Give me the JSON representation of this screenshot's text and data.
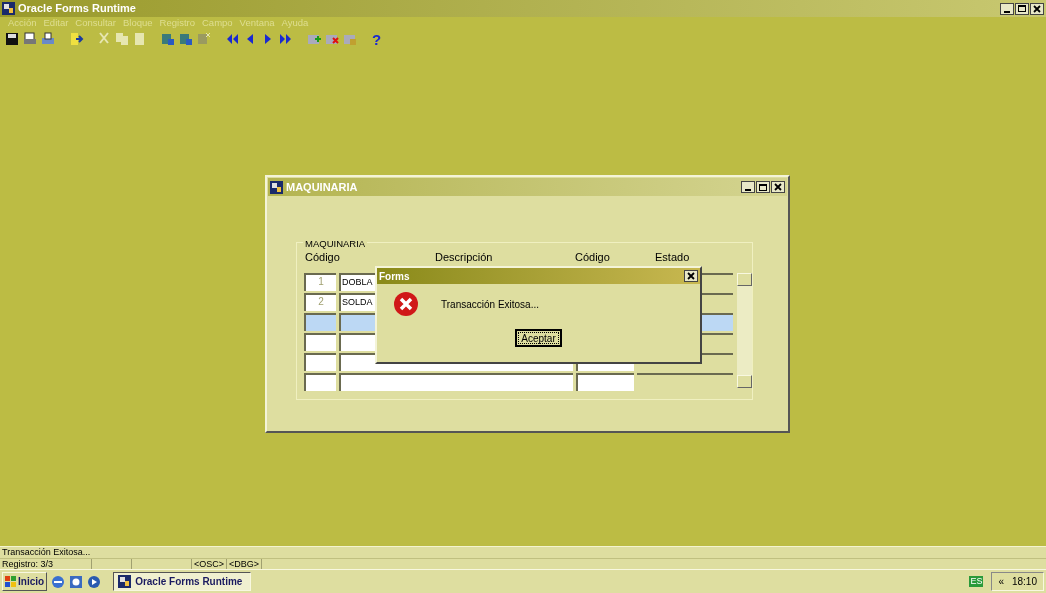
{
  "app_window": {
    "title": "Oracle Forms Runtime"
  },
  "menu": [
    {
      "label": "Acción",
      "disabled": true
    },
    {
      "label": "Editar",
      "disabled": true
    },
    {
      "label": "Consultar",
      "disabled": true
    },
    {
      "label": "Bloque",
      "disabled": true
    },
    {
      "label": "Registro",
      "disabled": true
    },
    {
      "label": "Campo",
      "disabled": true
    },
    {
      "label": "Ventana",
      "disabled": true
    },
    {
      "label": "Ayuda",
      "disabled": true
    }
  ],
  "help_button": "?",
  "form_window": {
    "title": "MAQUINARIA",
    "frame_title": "MAQUINARIA",
    "columns": [
      "Código",
      "Descripción",
      "Código",
      "Estado"
    ],
    "rows": [
      {
        "code": "1",
        "description": "DOBLA",
        "selected": false
      },
      {
        "code": "2",
        "description": "SOLDA",
        "selected": false
      },
      {
        "selected": true
      },
      {
        "selected": false
      },
      {
        "selected": false
      },
      {
        "selected": false
      }
    ]
  },
  "dialog": {
    "title": "Forms",
    "message": "Transacción Exitosa...",
    "button": "Aceptar"
  },
  "status_bar": {
    "message": "Transacción Exitosa...",
    "record": "Registro: 3/3",
    "indicators": [
      "<OSC>",
      "<DBG>"
    ]
  },
  "taskbar": {
    "start": "Inicio",
    "tasks": [
      {
        "label": "Oracle Forms Runtime",
        "active": true
      }
    ],
    "language": "ES",
    "tray_expander": "«",
    "clock": "18:10"
  }
}
